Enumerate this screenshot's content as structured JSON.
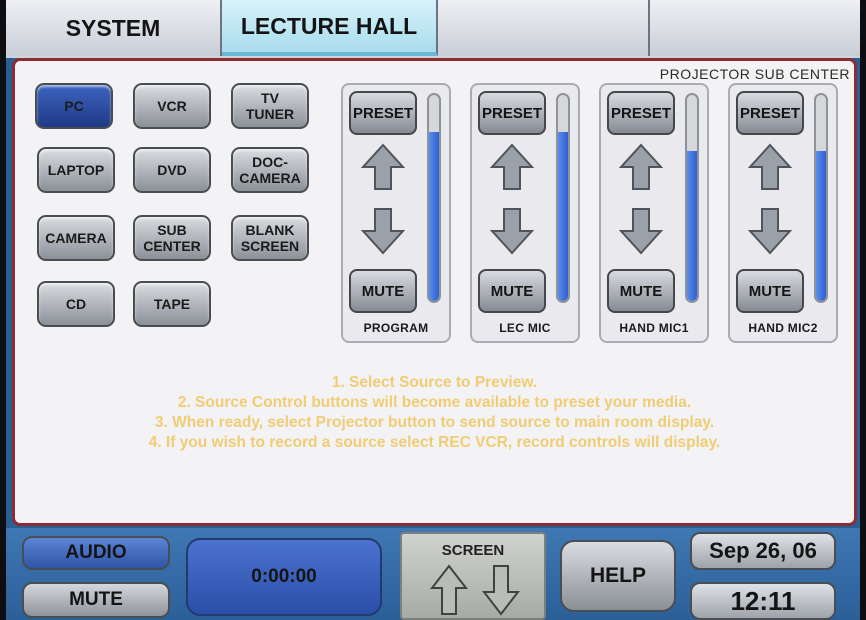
{
  "tabs": [
    {
      "label": "SYSTEM",
      "active": false
    },
    {
      "label": "LECTURE HALL",
      "active": true
    },
    {
      "label": "",
      "active": false
    },
    {
      "label": "",
      "active": false
    }
  ],
  "main": {
    "sub_center_label": "PROJECTOR SUB CENTER",
    "sources": [
      {
        "label": "PC",
        "selected": true
      },
      {
        "label": "VCR",
        "selected": false
      },
      {
        "label": "TV\nTUNER",
        "selected": false
      },
      {
        "label": "LAPTOP",
        "selected": false
      },
      {
        "label": "DVD",
        "selected": false
      },
      {
        "label": "DOC-\nCAMERA",
        "selected": false
      },
      {
        "label": "CAMERA",
        "selected": false
      },
      {
        "label": "SUB\nCENTER",
        "selected": false
      },
      {
        "label": "BLANK\nSCREEN",
        "selected": false
      },
      {
        "label": "CD",
        "selected": false
      },
      {
        "label": "TAPE",
        "selected": false
      }
    ],
    "channels": [
      {
        "name": "PROGRAM",
        "preset_label": "PRESET",
        "mute_label": "MUTE",
        "level": 0.82
      },
      {
        "name": "LEC MIC",
        "preset_label": "PRESET",
        "mute_label": "MUTE",
        "level": 0.82
      },
      {
        "name": "HAND MIC1",
        "preset_label": "PRESET",
        "mute_label": "MUTE",
        "level": 0.73
      },
      {
        "name": "HAND MIC2",
        "preset_label": "PRESET",
        "mute_label": "MUTE",
        "level": 0.73
      }
    ],
    "instructions": [
      "1. Select Source to Preview.",
      "2. Source Control buttons will become available to preset your media.",
      "3. When ready, select Projector button to send source to main room display.",
      "4. If you wish to record a source select REC VCR, record controls will display."
    ]
  },
  "bottom": {
    "audio_label": "AUDIO",
    "mute_label": "MUTE",
    "timer": "0:00:00",
    "screen_label": "SCREEN",
    "help_label": "HELP",
    "date": "Sep 26, 06",
    "time": "12:11"
  },
  "colors": {
    "accent_blue": "#2f5fd0",
    "instruction_text": "#f0cc74",
    "panel_border": "#8c2c35"
  }
}
